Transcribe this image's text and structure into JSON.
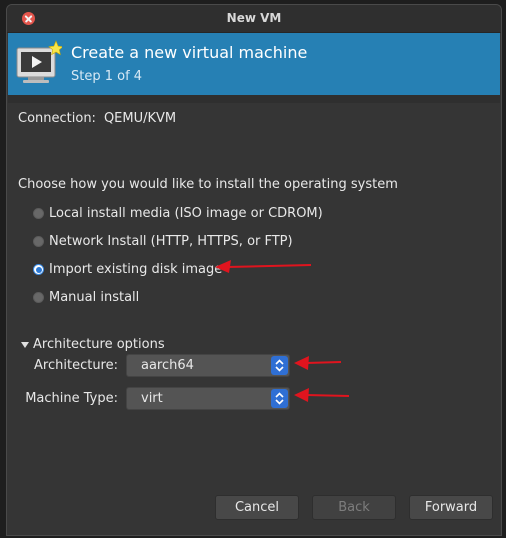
{
  "window": {
    "title": "New VM"
  },
  "header": {
    "title": "Create a new virtual machine",
    "step": "Step 1 of 4",
    "accent": "#2680b4"
  },
  "connection": {
    "label": "Connection:",
    "value": "QEMU/KVM"
  },
  "install": {
    "prompt": "Choose how you would like to install the operating system",
    "options": [
      {
        "label": "Local install media (ISO image or CDROM)",
        "selected": false
      },
      {
        "label": "Network Install (HTTP, HTTPS, or FTP)",
        "selected": false
      },
      {
        "label": "Import existing disk image",
        "selected": true
      },
      {
        "label": "Manual install",
        "selected": false
      }
    ]
  },
  "arch": {
    "expander_label": "Architecture options",
    "architecture_label": "Architecture:",
    "architecture_value": "aarch64",
    "machine_type_label": "Machine Type:",
    "machine_type_value": "virt"
  },
  "buttons": {
    "cancel": "Cancel",
    "back": "Back",
    "forward": "Forward"
  },
  "annotation_color": "#e0141e"
}
